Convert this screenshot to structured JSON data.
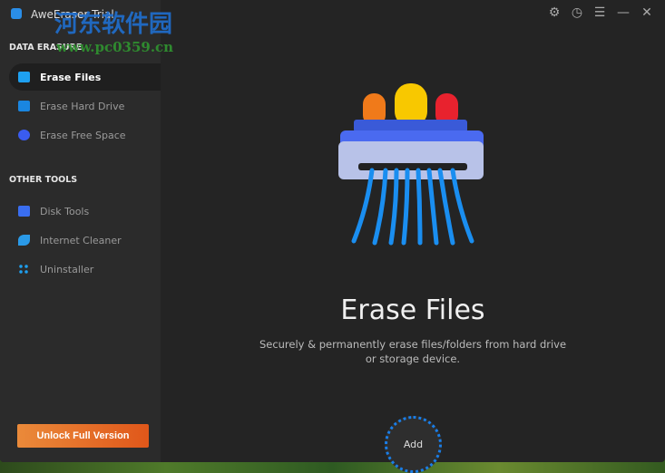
{
  "window": {
    "title": "AweEraser Trial"
  },
  "watermark": {
    "text": "河东软件园",
    "url": "www.pc0359.cn"
  },
  "sidebar": {
    "data_erasure_heading": "DATA ERASURE",
    "data_items": [
      {
        "label": "Erase Files",
        "icon": "folder-icon",
        "active": true
      },
      {
        "label": "Erase Hard Drive",
        "icon": "hard-drive-icon"
      },
      {
        "label": "Erase Free Space",
        "icon": "pie-chart-icon"
      }
    ],
    "other_tools_heading": "OTHER TOOLS",
    "tool_items": [
      {
        "label": "Disk Tools",
        "icon": "toolbox-icon"
      },
      {
        "label": "Internet Cleaner",
        "icon": "rocket-icon"
      },
      {
        "label": "Uninstaller",
        "icon": "apps-icon"
      }
    ],
    "unlock_label": "Unlock Full Version"
  },
  "main": {
    "title": "Erase Files",
    "description_line1": "Securely & permanently erase files/folders from hard drive",
    "description_line2": "or storage device.",
    "add_label": "Add"
  },
  "colors": {
    "accent": "#1a7ee8",
    "unlock": "#e0571a"
  }
}
